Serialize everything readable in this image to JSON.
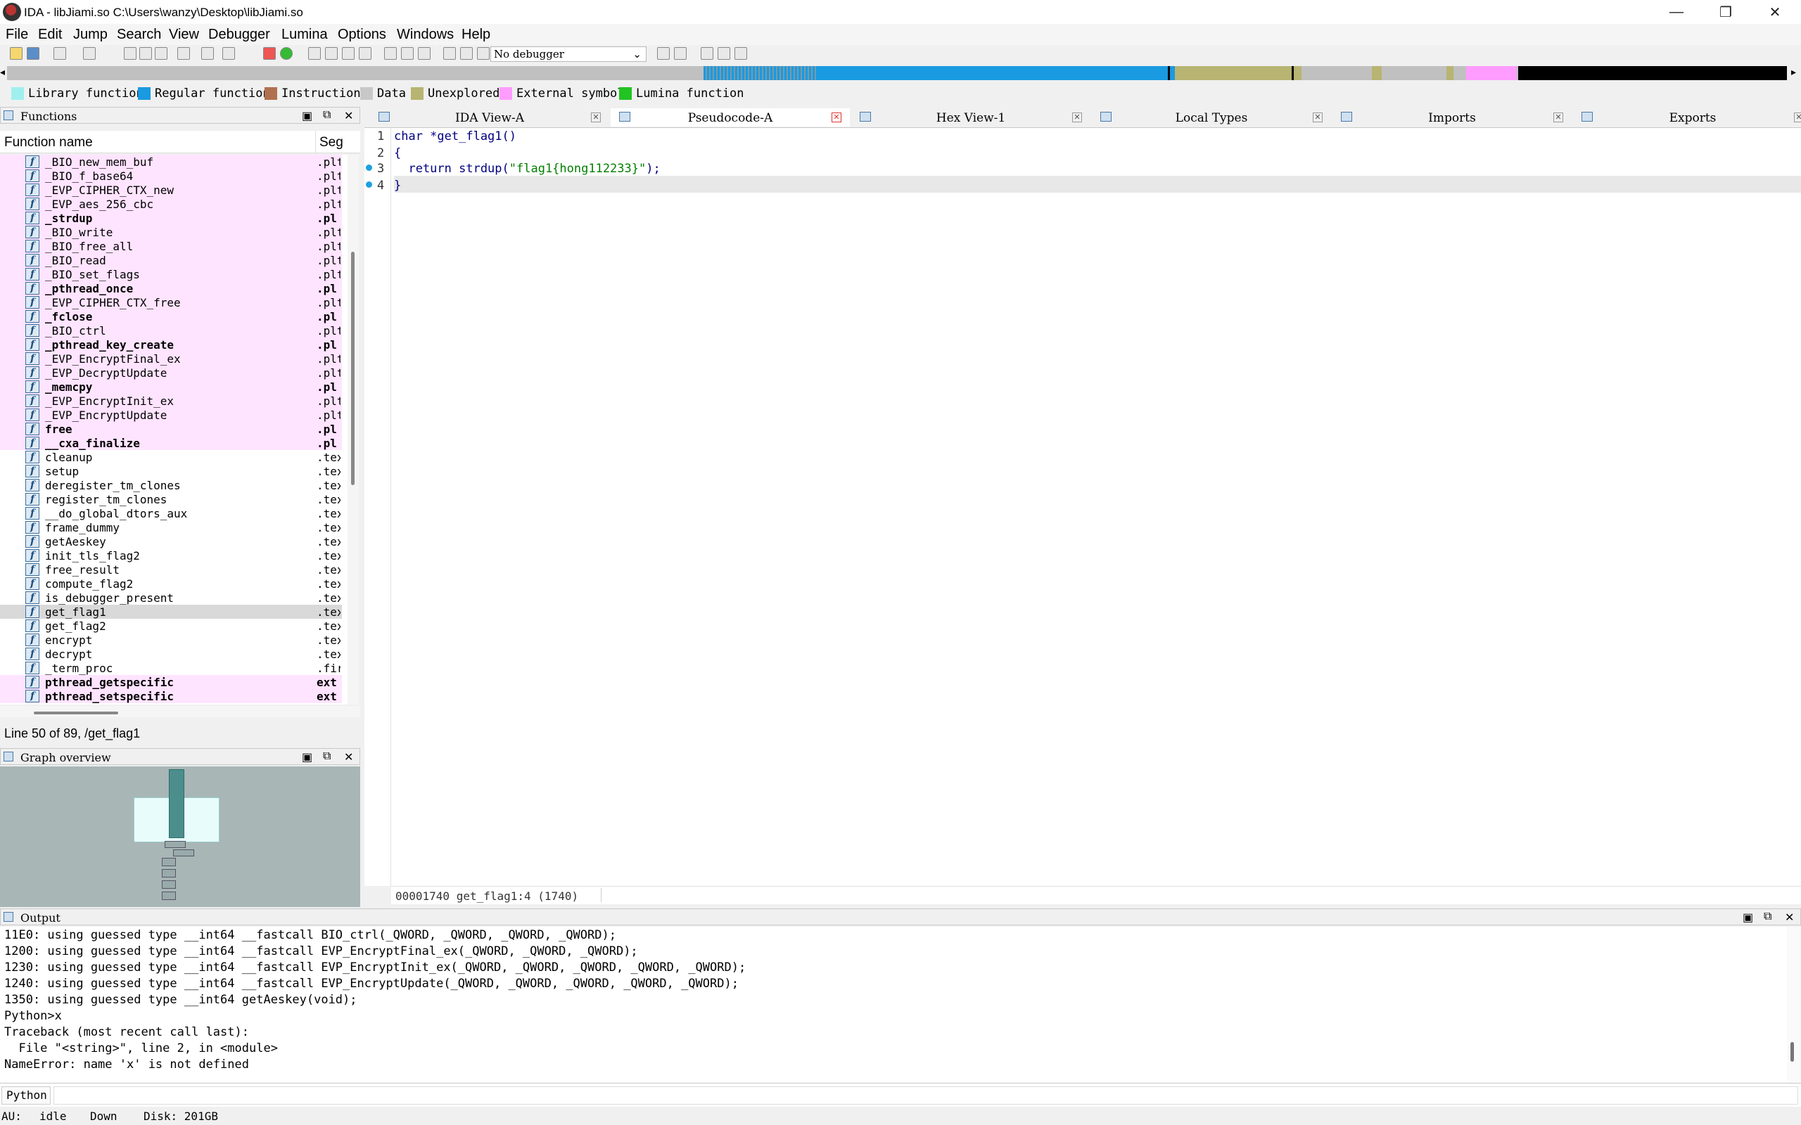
{
  "window": {
    "title": "IDA - libJiami.so C:\\Users\\wanzy\\Desktop\\libJiami.so"
  },
  "menu": [
    "File",
    "Edit",
    "Jump",
    "Search",
    "View",
    "Debugger",
    "Lumina",
    "Options",
    "Windows",
    "Help"
  ],
  "toolbar": {
    "debugger": "No debugger"
  },
  "legend": [
    {
      "label": "Library function",
      "color": "#9fefef"
    },
    {
      "label": "Regular function",
      "color": "#1a9ae0"
    },
    {
      "label": "Instruction",
      "color": "#b07050"
    },
    {
      "label": "Data",
      "color": "#c8c8c8"
    },
    {
      "label": "Unexplored",
      "color": "#b8b472"
    },
    {
      "label": "External symbol",
      "color": "#ff9cff"
    },
    {
      "label": "Lumina function",
      "color": "#22c322"
    }
  ],
  "functions": {
    "title": "Functions",
    "col_name": "Function name",
    "col_seg": "Seg",
    "status": "Line 50 of 89, /get_flag1",
    "rows": [
      {
        "name": "_BIO_new_mem_buf",
        "seg": ".plt",
        "bold": false,
        "pink": true
      },
      {
        "name": "_BIO_f_base64",
        "seg": ".plt",
        "bold": false,
        "pink": true
      },
      {
        "name": "_EVP_CIPHER_CTX_new",
        "seg": ".plt",
        "bold": false,
        "pink": true
      },
      {
        "name": "_EVP_aes_256_cbc",
        "seg": ".plt",
        "bold": false,
        "pink": true
      },
      {
        "name": "_strdup",
        "seg": ".pl",
        "bold": true,
        "pink": true
      },
      {
        "name": "_BIO_write",
        "seg": ".plt",
        "bold": false,
        "pink": true
      },
      {
        "name": "_BIO_free_all",
        "seg": ".plt",
        "bold": false,
        "pink": true
      },
      {
        "name": "_BIO_read",
        "seg": ".plt",
        "bold": false,
        "pink": true
      },
      {
        "name": "_BIO_set_flags",
        "seg": ".plt",
        "bold": false,
        "pink": true
      },
      {
        "name": "_pthread_once",
        "seg": ".pl",
        "bold": true,
        "pink": true
      },
      {
        "name": "_EVP_CIPHER_CTX_free",
        "seg": ".plt",
        "bold": false,
        "pink": true
      },
      {
        "name": "_fclose",
        "seg": ".pl",
        "bold": true,
        "pink": true
      },
      {
        "name": "_BIO_ctrl",
        "seg": ".plt",
        "bold": false,
        "pink": true
      },
      {
        "name": "_pthread_key_create",
        "seg": ".pl",
        "bold": true,
        "pink": true
      },
      {
        "name": "_EVP_EncryptFinal_ex",
        "seg": ".plt",
        "bold": false,
        "pink": true
      },
      {
        "name": "_EVP_DecryptUpdate",
        "seg": ".plt",
        "bold": false,
        "pink": true
      },
      {
        "name": "_memcpy",
        "seg": ".pl",
        "bold": true,
        "pink": true
      },
      {
        "name": "_EVP_EncryptInit_ex",
        "seg": ".plt",
        "bold": false,
        "pink": true
      },
      {
        "name": "_EVP_EncryptUpdate",
        "seg": ".plt",
        "bold": false,
        "pink": true
      },
      {
        "name": "free",
        "seg": ".pl",
        "bold": true,
        "pink": true
      },
      {
        "name": "__cxa_finalize",
        "seg": ".pl",
        "bold": true,
        "pink": true
      },
      {
        "name": "cleanup",
        "seg": ".tex",
        "bold": false,
        "pink": false
      },
      {
        "name": "setup",
        "seg": ".tex",
        "bold": false,
        "pink": false
      },
      {
        "name": "deregister_tm_clones",
        "seg": ".tex",
        "bold": false,
        "pink": false
      },
      {
        "name": "register_tm_clones",
        "seg": ".tex",
        "bold": false,
        "pink": false
      },
      {
        "name": "__do_global_dtors_aux",
        "seg": ".tex",
        "bold": false,
        "pink": false
      },
      {
        "name": "frame_dummy",
        "seg": ".tex",
        "bold": false,
        "pink": false
      },
      {
        "name": "getAeskey",
        "seg": ".tex",
        "bold": false,
        "pink": false
      },
      {
        "name": "init_tls_flag2",
        "seg": ".tex",
        "bold": false,
        "pink": false
      },
      {
        "name": "free_result",
        "seg": ".tex",
        "bold": false,
        "pink": false
      },
      {
        "name": "compute_flag2",
        "seg": ".tex",
        "bold": false,
        "pink": false
      },
      {
        "name": "is_debugger_present",
        "seg": ".tex",
        "bold": false,
        "pink": false
      },
      {
        "name": "get_flag1",
        "seg": ".tex",
        "bold": false,
        "pink": false,
        "selected": true
      },
      {
        "name": "get_flag2",
        "seg": ".tex",
        "bold": false,
        "pink": false
      },
      {
        "name": "encrypt",
        "seg": ".tex",
        "bold": false,
        "pink": false
      },
      {
        "name": "decrypt",
        "seg": ".tex",
        "bold": false,
        "pink": false
      },
      {
        "name": "_term_proc",
        "seg": ".fir",
        "bold": false,
        "pink": false
      },
      {
        "name": "pthread_getspecific",
        "seg": "ext",
        "bold": true,
        "pink": true
      },
      {
        "name": "pthread_setspecific",
        "seg": "ext",
        "bold": true,
        "pink": true
      }
    ]
  },
  "graph": {
    "title": "Graph overview"
  },
  "tabs": [
    {
      "label": "IDA View-A",
      "active": false
    },
    {
      "label": "Pseudocode-A",
      "active": true
    },
    {
      "label": "Hex View-1",
      "active": false
    },
    {
      "label": "Local Types",
      "active": false
    },
    {
      "label": "Imports",
      "active": false
    },
    {
      "label": "Exports",
      "active": false
    }
  ],
  "code": {
    "lines": [
      {
        "num": "1",
        "text": "char *get_flag1()",
        "bp": false
      },
      {
        "num": "2",
        "text": "{",
        "bp": false
      },
      {
        "num": "3",
        "text": "  return strdup(\"flag1{hong112233}\");",
        "bp": true
      },
      {
        "num": "4",
        "text": "}",
        "bp": true
      }
    ],
    "status": "00001740 get_flag1:4 (1740)"
  },
  "output": {
    "title": "Output",
    "lines": [
      "11E0: using guessed type __int64 __fastcall BIO_ctrl(_QWORD, _QWORD, _QWORD, _QWORD);",
      "1200: using guessed type __int64 __fastcall EVP_EncryptFinal_ex(_QWORD, _QWORD, _QWORD);",
      "1230: using guessed type __int64 __fastcall EVP_EncryptInit_ex(_QWORD, _QWORD, _QWORD, _QWORD, _QWORD);",
      "1240: using guessed type __int64 __fastcall EVP_EncryptUpdate(_QWORD, _QWORD, _QWORD, _QWORD, _QWORD);",
      "1350: using guessed type __int64 getAeskey(void);",
      "Python>x",
      "Traceback (most recent call last):",
      "  File \"<string>\", line 2, in <module>",
      "NameError: name 'x' is not defined"
    ]
  },
  "python": {
    "label": "Python"
  },
  "status": {
    "au": "AU:",
    "state": "idle",
    "dir": "Down",
    "disk": "Disk: 201GB"
  }
}
